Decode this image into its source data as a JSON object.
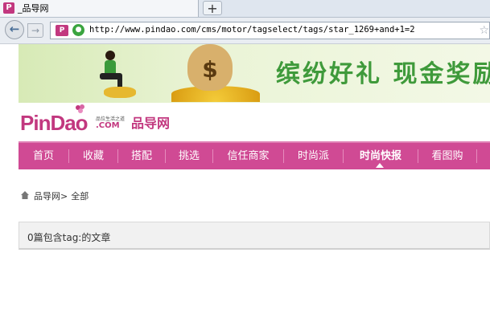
{
  "browser": {
    "tab_title": "_品导网",
    "tab_favicon": "pindao-favicon",
    "new_tab_label": "+",
    "back_icon": "back-arrow-icon",
    "forward_icon": "forward-arrow-icon",
    "url": "http://www.pindao.com/cms/motor/tagselect/tags/star_1269+and+1=2",
    "bookmark_icon": "star-icon"
  },
  "banner": {
    "slogan": "缤纷好礼  现金奖励",
    "bag_symbol": "$"
  },
  "site": {
    "logo_text": "PinDao",
    "logo_sub": "品位生活之道",
    "logo_com": ".COM",
    "logo_cn": "品导网",
    "brand_color": "#d04a94"
  },
  "nav": {
    "items": [
      {
        "label": "首页"
      },
      {
        "label": "收藏"
      },
      {
        "label": "搭配"
      },
      {
        "label": "挑选"
      },
      {
        "label": "信任商家"
      },
      {
        "label": "时尚派"
      },
      {
        "label": "时尚快报"
      },
      {
        "label": "看图购"
      }
    ],
    "active_index": 6
  },
  "breadcrumb": {
    "home_label": "品导网",
    "separator": ">",
    "current": "全部"
  },
  "result": {
    "text": "0篇包含tag:的文章"
  }
}
